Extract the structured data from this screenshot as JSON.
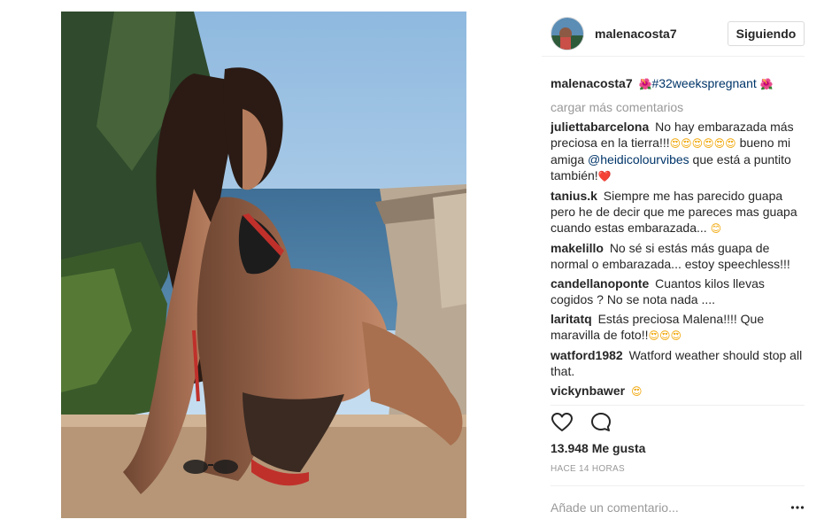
{
  "post": {
    "username": "malenacosta7",
    "follow_label": "Siguiendo",
    "caption_user": "malenacosta7",
    "caption_hashtag": "#32weekspregnant",
    "load_more": "cargar más comentarios",
    "comments": [
      {
        "user": "juliettabarcelona",
        "text_before": "No hay embarazada más preciosa en la tierra!!!",
        "emoji1": "😍😍😍😍😍😍",
        "text_middle": " bueno mi amiga ",
        "mention": "@heidicolourvibes",
        "text_after": " que está a puntito también!",
        "emoji2": "❤️"
      },
      {
        "user": "tanius.k",
        "text": "Siempre me has parecido guapa pero he de decir que me pareces mas guapa cuando estas embarazada... ",
        "emoji": "😊"
      },
      {
        "user": "makelillo",
        "text": "No sé si estás más guapa de normal o embarazada... estoy speechless!!!"
      },
      {
        "user": "candellanoponte",
        "text": "Cuantos kilos llevas cogidos ? No se nota nada ...."
      },
      {
        "user": "laritatq",
        "text": "Estás preciosa Malena!!!! Que maravilla de foto!!",
        "emoji": "😍😍😍"
      },
      {
        "user": "watford1982",
        "text": "Watford weather should stop all that."
      },
      {
        "user": "vickynbawer",
        "text": "",
        "emoji": "😍"
      }
    ],
    "flower_emoji": "🌺",
    "likes": "13.948 Me gusta",
    "time": "HACE 14 HORAS",
    "add_comment_placeholder": "Añade un comentario...",
    "icons": [
      "heart-icon",
      "comment-icon",
      "more-options-icon"
    ]
  }
}
